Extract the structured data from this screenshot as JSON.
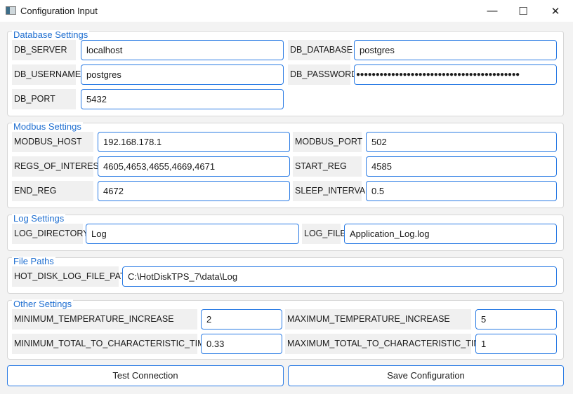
{
  "window": {
    "title": "Configuration Input",
    "minimize": "—",
    "maximize": "☐",
    "close": "✕"
  },
  "database": {
    "title": "Database Settings",
    "db_server_label": "DB_SERVER",
    "db_server": "localhost",
    "db_database_label": "DB_DATABASE",
    "db_database": "postgres",
    "db_username_label": "DB_USERNAME",
    "db_username": "postgres",
    "db_password_label": "DB_PASSWORD",
    "db_password": "●●●●●●●●●●●●●●●●●●●●●●●●●●●●●●●●●●●●●●●●●●",
    "db_port_label": "DB_PORT",
    "db_port": "5432"
  },
  "modbus": {
    "title": "Modbus Settings",
    "host_label": "MODBUS_HOST",
    "host": "192.168.178.1",
    "port_label": "MODBUS_PORT",
    "port": "502",
    "regs_label": "REGS_OF_INTEREST",
    "regs": "4605,4653,4655,4669,4671",
    "start_label": "START_REG",
    "start": "4585",
    "end_label": "END_REG",
    "end": "4672",
    "sleep_label": "SLEEP_INTERVAL",
    "sleep": "0.5"
  },
  "log": {
    "title": "Log Settings",
    "dir_label": "LOG_DIRECTORY",
    "dir": "Log",
    "file_label": "LOG_FILE",
    "file": "Application_Log.log"
  },
  "paths": {
    "title": "File Paths",
    "hot_label": "HOT_DISK_LOG_FILE_PATH",
    "hot": "C:\\HotDiskTPS_7\\data\\Log"
  },
  "other": {
    "title": "Other Settings",
    "min_temp_label": "MINIMUM_TEMPERATURE_INCREASE",
    "min_temp": "2",
    "max_temp_label": "MAXIMUM_TEMPERATURE_INCREASE",
    "max_temp": "5",
    "min_time_label": "MINIMUM_TOTAL_TO_CHARACTERISTIC_TIME",
    "min_time": "0.33",
    "max_time_label": "MAXIMUM_TOTAL_TO_CHARACTERISTIC_TIME",
    "max_time": "1"
  },
  "buttons": {
    "test": "Test Connection",
    "save": "Save Configuration"
  }
}
